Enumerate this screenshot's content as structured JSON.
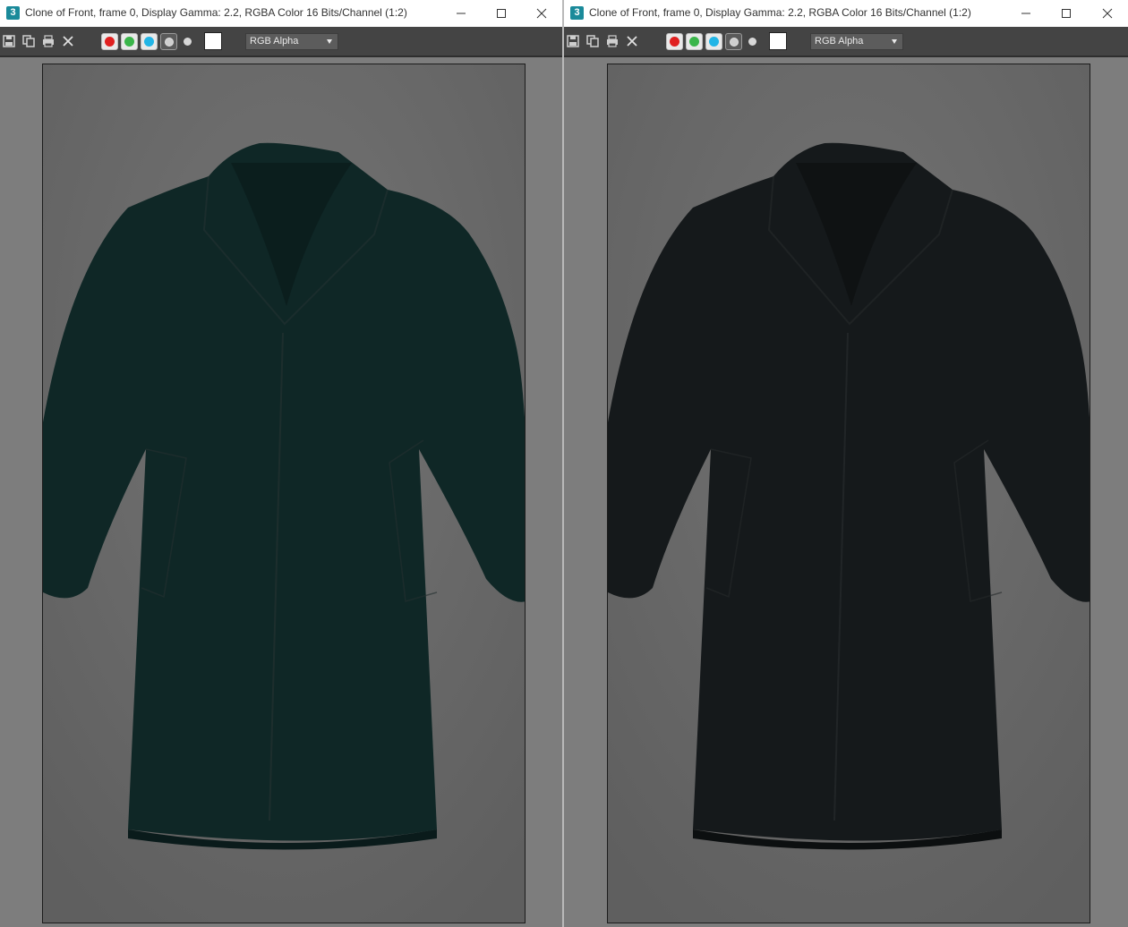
{
  "app_icon_label": "3",
  "windows": [
    {
      "title": "Clone of Front, frame 0, Display Gamma: 2.2, RGBA Color 16 Bits/Channel (1:2)",
      "channel_dropdown": "RGB Alpha",
      "coat_color": "#0f2726",
      "coat_shadow": "#0a1b1b",
      "colors": {
        "red": "#e02020",
        "green": "#3ab54a",
        "blue": "#22b5e6",
        "swatch": "#ffffff"
      }
    },
    {
      "title": "Clone of Front, frame 0, Display Gamma: 2.2, RGBA Color 16 Bits/Channel (1:2)",
      "channel_dropdown": "RGB Alpha",
      "coat_color": "#15191b",
      "coat_shadow": "#0c0f10",
      "colors": {
        "red": "#e02020",
        "green": "#3ab54a",
        "blue": "#22b5e6",
        "swatch": "#ffffff"
      }
    }
  ],
  "icons": [
    "save-icon",
    "copy-icon",
    "print-icon",
    "clear-icon",
    "minimize-icon",
    "maximize-icon",
    "close-icon"
  ]
}
